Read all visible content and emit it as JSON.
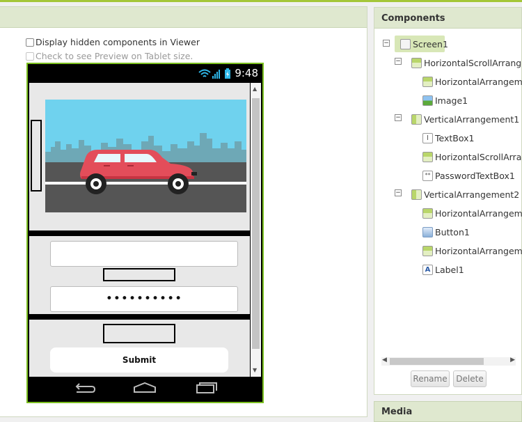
{
  "viewer": {
    "display_hidden_label": "Display hidden components in Viewer",
    "tablet_preview_label": "Check to see Preview on Tablet size."
  },
  "phone": {
    "clock": "9:48",
    "password_mask": "••••••••••",
    "submit_label": "Submit"
  },
  "components": {
    "title": "Components",
    "tree": [
      {
        "label": "Screen1",
        "icon": "screen-icon",
        "expanded": true,
        "selected": true
      },
      {
        "label": "HorizontalScrollArrangem",
        "icon": "horizontal-arrangement-icon",
        "expanded": true
      },
      {
        "label": "HorizontalArrangemen",
        "icon": "horizontal-arrangement-icon"
      },
      {
        "label": "Image1",
        "icon": "image-icon"
      },
      {
        "label": "VerticalArrangement1",
        "icon": "vertical-arrangement-icon",
        "expanded": true
      },
      {
        "label": "TextBox1",
        "icon": "textbox-icon"
      },
      {
        "label": "HorizontalScrollArrang",
        "icon": "horizontal-arrangement-icon"
      },
      {
        "label": "PasswordTextBox1",
        "icon": "password-textbox-icon"
      },
      {
        "label": "VerticalArrangement2",
        "icon": "vertical-arrangement-icon",
        "expanded": true
      },
      {
        "label": "HorizontalArrangemen",
        "icon": "horizontal-arrangement-icon"
      },
      {
        "label": "Button1",
        "icon": "button-icon"
      },
      {
        "label": "HorizontalArrangemen",
        "icon": "horizontal-arrangement-icon"
      },
      {
        "label": "Label1",
        "icon": "label-icon"
      }
    ],
    "rename_label": "Rename",
    "delete_label": "Delete"
  },
  "media": {
    "title": "Media"
  },
  "colors": {
    "accent": "#a4c639",
    "phone_border": "#7bbf1f",
    "header_bg": "#dfe8cf"
  }
}
